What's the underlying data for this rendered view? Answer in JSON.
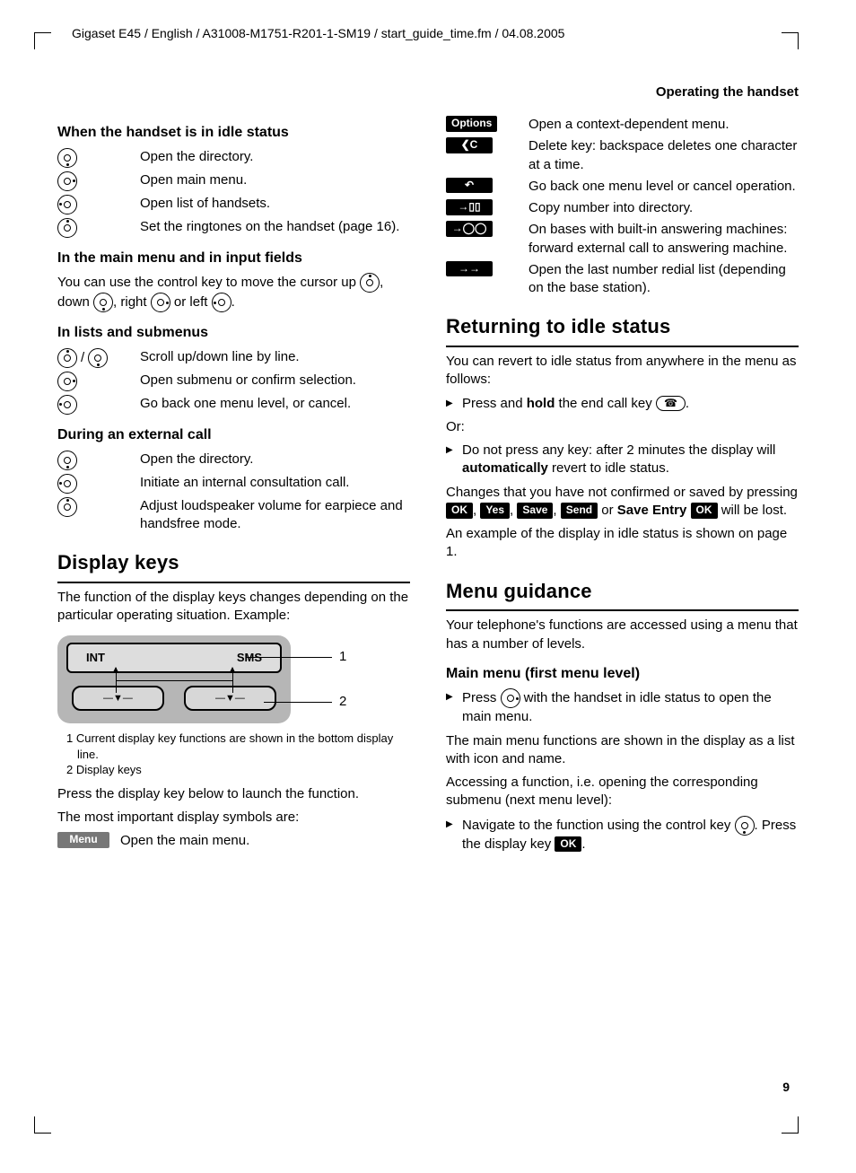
{
  "header_line": "Gigaset E45 / English / A31008-M1751-R201-1-SM19 / start_guide_time.fm / 04.08.2005",
  "running_head": "Operating the handset",
  "page_number": "9",
  "left": {
    "sub1": "When the handset is in idle status",
    "idle": [
      "Open the directory.",
      "Open main menu.",
      "Open list of handsets.",
      "Set the ringtones on the handset (page 16)."
    ],
    "sub2": "In the main menu and in input fields",
    "mainmenu_para_a": "You can use the control key to move the cursor up ",
    "mainmenu_para_b": ", down ",
    "mainmenu_para_c": ", right ",
    "mainmenu_para_d": " or left ",
    "mainmenu_para_e": ".",
    "sub3": "In lists and submenus",
    "lists": [
      "Scroll up/down line by line.",
      "Open submenu or confirm selection.",
      "Go back one menu level, or cancel."
    ],
    "sub4": "During an external call",
    "call": [
      "Open the directory.",
      "Initiate an internal consultation call.",
      "Adjust loudspeaker volume for earpiece and handsfree mode."
    ],
    "sec_display": "Display keys",
    "display_para": "The function of the display keys changes depending on the particular operating situation. Example:",
    "lcd_left": "INT",
    "lcd_right": "SMS",
    "callout1": "1",
    "callout2": "2",
    "key_glyph": "—▼—",
    "fignote1": "1 Current display key functions are shown in the bottom display line.",
    "fignote2": "2 Display keys",
    "display_para2": "Press the display key below to launch the function.",
    "display_para3": "The most important display symbols are:",
    "menu_label": "Menu",
    "menu_desc": "Open the main menu."
  },
  "right": {
    "symbols": [
      {
        "label": "Options",
        "cls": "",
        "text": "Open a context-dependent menu."
      },
      {
        "label": "❮C",
        "cls": "icon",
        "text": "Delete key: backspace deletes one character at a time."
      },
      {
        "label": "↶",
        "cls": "icon",
        "text": "Go back one menu level or cancel operation."
      },
      {
        "label": "→▯▯",
        "cls": "icon",
        "text": "Copy number into directory."
      },
      {
        "label": "→◯◯",
        "cls": "icon",
        "text": "On bases with built-in answering machines: forward external call to answering machine."
      },
      {
        "label": "→→",
        "cls": "icon",
        "text": "Open the last number redial list (depending on the base station)."
      }
    ],
    "sec_return": "Returning to idle status",
    "return_p1": "You can revert to idle status from anywhere in the menu as follows:",
    "return_b1a": "Press and ",
    "return_b1_bold": "hold",
    "return_b1b": " the end call key ",
    "return_b1c": ".",
    "return_or": "Or:",
    "return_b2a": "Do not press any key: after 2 minutes the display will ",
    "return_b2_bold": "automatically",
    "return_b2b": " revert to idle status.",
    "return_p2a": "Changes that you have not confirmed or saved by pressing ",
    "labels": {
      "ok": "OK",
      "yes": "Yes",
      "save": "Save",
      "send": "Send",
      "save_entry": "Save Entry"
    },
    "return_p2b": " or ",
    "return_p2c": " will be lost.",
    "return_p3": "An example of the display in idle status is shown on page 1.",
    "sec_menu": "Menu guidance",
    "menu_p1": "Your telephone's functions are accessed using a menu that has a number of levels.",
    "sub_main": "Main menu (first menu level)",
    "main_b1a": "Press ",
    "main_b1b": " with the handset in idle status to open the main menu.",
    "menu_p2": "The main menu functions are shown in the display as a list with icon and name.",
    "menu_p3": "Accessing a function, i.e. opening the corresponding submenu (next menu level):",
    "main_b2a": "Navigate to the function using the control key ",
    "main_b2b": ". Press the display key "
  }
}
